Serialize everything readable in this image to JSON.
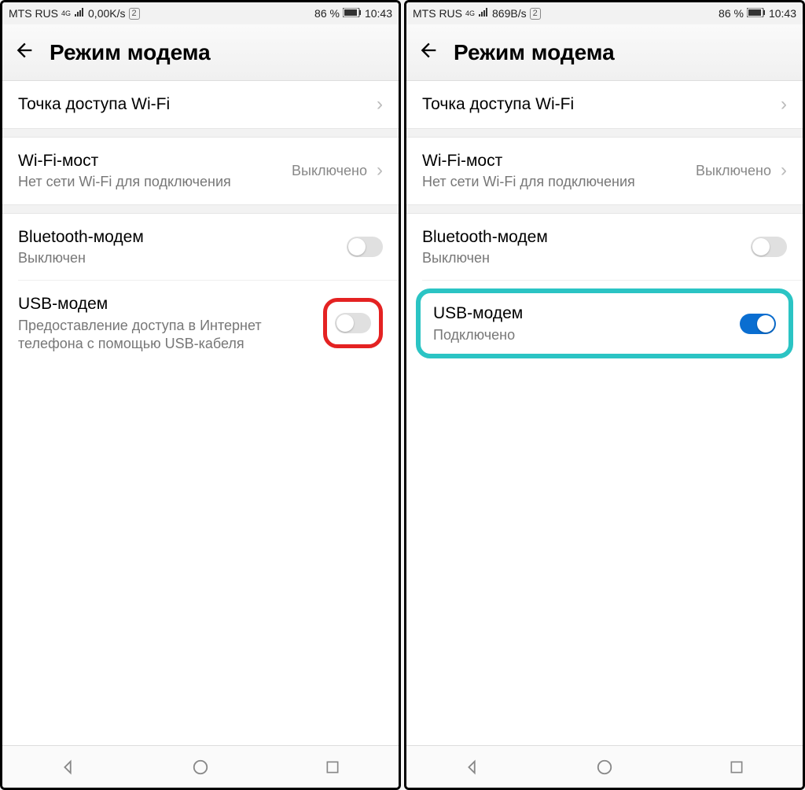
{
  "screens": [
    {
      "status": {
        "carrier": "MTS RUS",
        "net_mode": "4G",
        "speed": "0,00K/s",
        "sim": "2",
        "battery": "86 %",
        "time": "10:43"
      },
      "header": {
        "title": "Режим модема"
      },
      "rows": {
        "wifi_ap": {
          "title": "Точка доступа Wi-Fi"
        },
        "wifi_bridge": {
          "title": "Wi-Fi-мост",
          "sub": "Нет сети Wi-Fi для подключения",
          "value": "Выключено"
        },
        "bt_modem": {
          "title": "Bluetooth-модем",
          "sub": "Выключен",
          "toggle_on": false
        },
        "usb_modem": {
          "title": "USB-модем",
          "sub": "Предоставление доступа в Интернет телефона с помощью USB-кабеля",
          "toggle_on": false,
          "highlight": "red"
        }
      }
    },
    {
      "status": {
        "carrier": "MTS RUS",
        "net_mode": "4G",
        "speed": "869B/s",
        "sim": "2",
        "battery": "86 %",
        "time": "10:43"
      },
      "header": {
        "title": "Режим модема"
      },
      "rows": {
        "wifi_ap": {
          "title": "Точка доступа Wi-Fi"
        },
        "wifi_bridge": {
          "title": "Wi-Fi-мост",
          "sub": "Нет сети Wi-Fi для подключения",
          "value": "Выключено"
        },
        "bt_modem": {
          "title": "Bluetooth-модем",
          "sub": "Выключен",
          "toggle_on": false
        },
        "usb_modem": {
          "title": "USB-модем",
          "sub": "Подключено",
          "toggle_on": true,
          "highlight": "teal"
        }
      }
    }
  ]
}
